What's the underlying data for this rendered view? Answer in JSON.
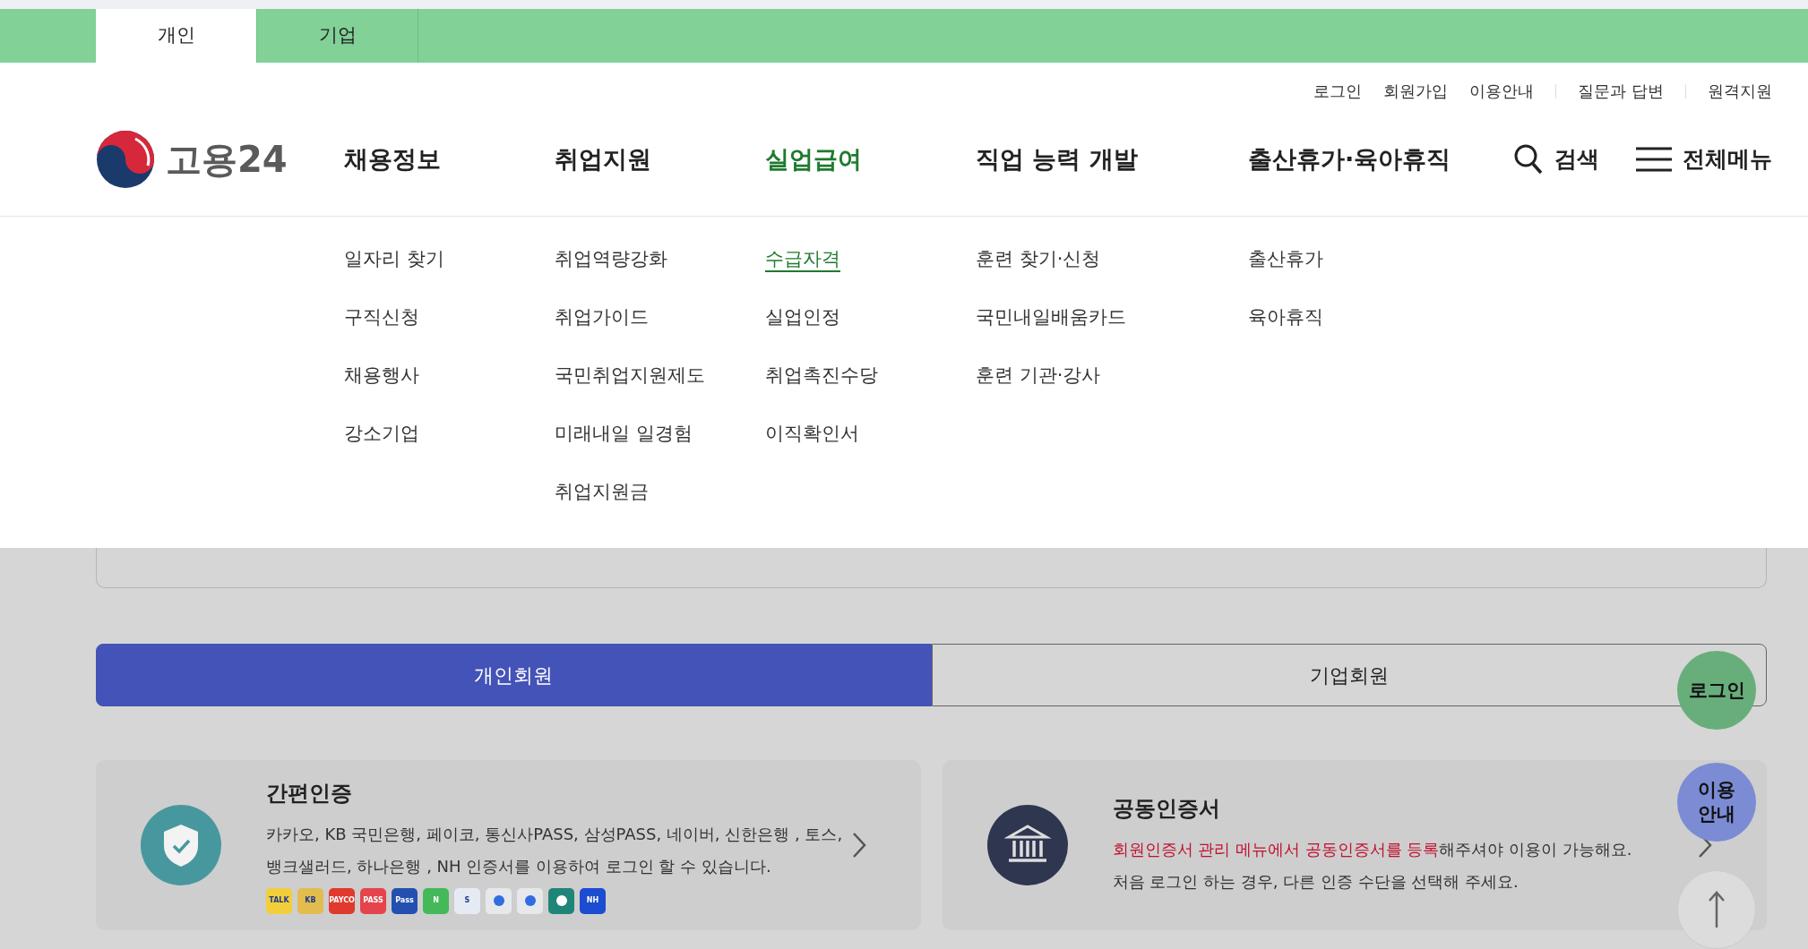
{
  "scope_tabs": [
    {
      "label": "개인",
      "selected": true
    },
    {
      "label": "기업",
      "selected": false
    }
  ],
  "utility_links": [
    "로그인",
    "회원가입",
    "이용안내",
    "질문과 답변",
    "원격지원"
  ],
  "logo": {
    "text": "고용24"
  },
  "nav": [
    {
      "label": "채용정보",
      "selected": false,
      "submenu": [
        {
          "label": "일자리 찾기",
          "selected": false
        },
        {
          "label": "구직신청",
          "selected": false
        },
        {
          "label": "채용행사",
          "selected": false
        },
        {
          "label": "강소기업",
          "selected": false
        }
      ]
    },
    {
      "label": "취업지원",
      "selected": false,
      "submenu": [
        {
          "label": "취업역량강화",
          "selected": false
        },
        {
          "label": "취업가이드",
          "selected": false
        },
        {
          "label": "국민취업지원제도",
          "selected": false
        },
        {
          "label": "미래내일 일경험",
          "selected": false
        },
        {
          "label": "취업지원금",
          "selected": false
        }
      ]
    },
    {
      "label": "실업급여",
      "selected": true,
      "submenu": [
        {
          "label": "수급자격",
          "selected": true
        },
        {
          "label": "실업인정",
          "selected": false
        },
        {
          "label": "취업촉진수당",
          "selected": false
        },
        {
          "label": "이직확인서",
          "selected": false
        }
      ]
    },
    {
      "label": "직업 능력 개발",
      "selected": false,
      "submenu": [
        {
          "label": "훈련 찾기·신청",
          "selected": false
        },
        {
          "label": "국민내일배움카드",
          "selected": false
        },
        {
          "label": "훈련 기관·강사",
          "selected": false
        }
      ]
    },
    {
      "label": "출산휴가·육아휴직",
      "selected": false,
      "submenu": [
        {
          "label": "출산휴가",
          "selected": false
        },
        {
          "label": "육아휴직",
          "selected": false
        }
      ]
    }
  ],
  "search": {
    "label": "검색"
  },
  "all_menu": {
    "label": "전체메뉴"
  },
  "member_tabs": [
    {
      "label": "개인회원",
      "selected": true
    },
    {
      "label": "기업회원",
      "selected": false
    }
  ],
  "cards": [
    {
      "kind": "simple",
      "title": "간편인증",
      "description": "카카오, KB 국민은행, 페이코, 통신사PASS, 삼성PASS, 네이버, 신한은행 , 토스, 뱅크샐러드, 하나은행 , NH 인증서를 이용하여 로그인 할 수 있습니다.",
      "brands": [
        {
          "label": "TALK",
          "color": "#f2cf3a"
        },
        {
          "label": "KB",
          "color": "#e3bc4e"
        },
        {
          "label": "PAYCO",
          "color": "#e0392e"
        },
        {
          "label": "PASS",
          "color": "#e5444d"
        },
        {
          "label": "Pass",
          "color": "#2350b0"
        },
        {
          "label": "N",
          "color": "#43b95a"
        },
        {
          "label": "S",
          "color": "#e6ebf3"
        },
        {
          "color": "#e6e8ec"
        },
        {
          "color": "#e6e8ec"
        },
        {
          "color": "#1f8578"
        },
        {
          "label": "NH",
          "color": "#1c4ccf"
        }
      ]
    },
    {
      "kind": "certificate",
      "title": "공동인증서",
      "description": "**회원인증서 관리 메뉴에서 공동인증서를 등록**해주셔야 이용이 가능해요.",
      "note": "처음 로그인 하는 경우, 다른 인증 수단을 선택해 주세요."
    }
  ],
  "floating": [
    {
      "kind": "login",
      "label": "로그인"
    },
    {
      "kind": "guide",
      "label": "이용안내"
    },
    {
      "kind": "top"
    }
  ]
}
